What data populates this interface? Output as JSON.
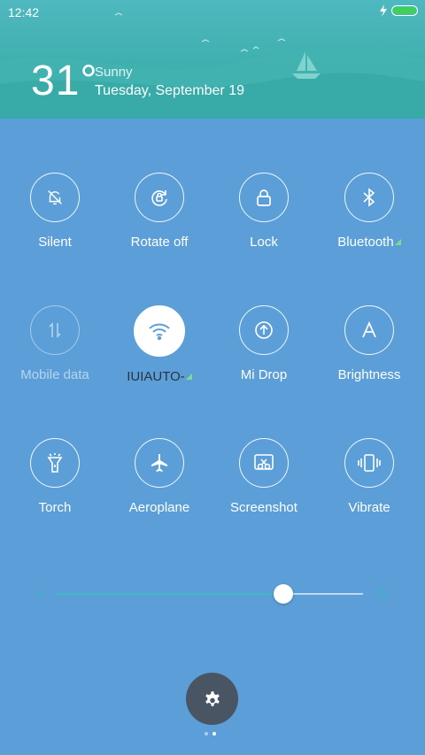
{
  "status_bar": {
    "time": "12:42",
    "battery_level": 1.0
  },
  "weather": {
    "temperature": "31°",
    "condition": "Sunny",
    "date": "Tuesday, September 19"
  },
  "toggles": [
    {
      "label": "Silent",
      "icon": "bell-off-icon",
      "state": "off"
    },
    {
      "label": "Rotate off",
      "icon": "rotate-lock-icon",
      "state": "off"
    },
    {
      "label": "Lock",
      "icon": "lock-icon",
      "state": "off"
    },
    {
      "label": "Bluetooth",
      "icon": "bluetooth-icon",
      "state": "off"
    },
    {
      "label": "Mobile data",
      "icon": "mobile-data-icon",
      "state": "disabled"
    },
    {
      "label": "IUIAUTO-",
      "icon": "wifi-icon",
      "state": "on"
    },
    {
      "label": "Mi Drop",
      "icon": "mi-drop-icon",
      "state": "off"
    },
    {
      "label": "Brightness",
      "icon": "brightness-auto-icon",
      "state": "off"
    },
    {
      "label": "Torch",
      "icon": "torch-icon",
      "state": "off"
    },
    {
      "label": "Aeroplane",
      "icon": "airplane-icon",
      "state": "off"
    },
    {
      "label": "Screenshot",
      "icon": "screenshot-icon",
      "state": "off"
    },
    {
      "label": "Vibrate",
      "icon": "vibrate-icon",
      "state": "off"
    }
  ],
  "brightness": {
    "level": 0.74
  },
  "pager": {
    "pages": 2,
    "current": 2
  },
  "colors": {
    "panel": "#5c9fd8",
    "header": "#3fb0ae",
    "fab": "#4a5563",
    "accent": "#40b8c8"
  }
}
